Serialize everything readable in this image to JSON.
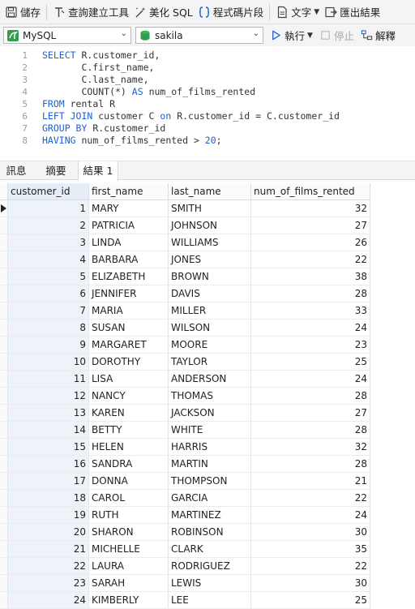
{
  "toolbar": {
    "save": "儲存",
    "query_builder": "查詢建立工具",
    "beautify": "美化 SQL",
    "snippet": "程式碼片段",
    "text": "文字",
    "export": "匯出結果"
  },
  "connection": {
    "engine": "MySQL",
    "database": "sakila",
    "run": "執行",
    "stop": "停止",
    "explain": "解釋"
  },
  "editor": {
    "lines": [
      {
        "n": "1",
        "parts": [
          {
            "t": "SELECT",
            "k": 1
          },
          {
            "t": " R.customer_id,",
            "k": 0
          }
        ]
      },
      {
        "n": "2",
        "parts": [
          {
            "t": "       C.first_name,",
            "k": 0
          }
        ]
      },
      {
        "n": "3",
        "parts": [
          {
            "t": "       C.last_name,",
            "k": 0
          }
        ]
      },
      {
        "n": "4",
        "parts": [
          {
            "t": "       COUNT(*) ",
            "k": 0
          },
          {
            "t": "AS",
            "k": 1
          },
          {
            "t": " num_of_films_rented",
            "k": 0
          }
        ]
      },
      {
        "n": "5",
        "parts": [
          {
            "t": "FROM",
            "k": 1
          },
          {
            "t": " rental R",
            "k": 0
          }
        ]
      },
      {
        "n": "6",
        "parts": [
          {
            "t": "LEFT JOIN",
            "k": 1
          },
          {
            "t": " customer C ",
            "k": 0
          },
          {
            "t": "on",
            "k": 1
          },
          {
            "t": " R.customer_id = C.customer_id",
            "k": 0
          }
        ]
      },
      {
        "n": "7",
        "parts": [
          {
            "t": "GROUP BY",
            "k": 1
          },
          {
            "t": " R.customer_id",
            "k": 0
          }
        ]
      },
      {
        "n": "8",
        "parts": [
          {
            "t": "HAVING",
            "k": 1
          },
          {
            "t": " num_of_films_rented > ",
            "k": 0
          },
          {
            "t": "20",
            "k": 2
          },
          {
            "t": ";",
            "k": 0
          }
        ]
      }
    ]
  },
  "tabs": [
    "訊息",
    "摘要",
    "結果 1"
  ],
  "grid": {
    "columns": [
      "customer_id",
      "first_name",
      "last_name",
      "num_of_films_rented"
    ],
    "rows": [
      [
        "1",
        "MARY",
        "SMITH",
        "32"
      ],
      [
        "2",
        "PATRICIA",
        "JOHNSON",
        "27"
      ],
      [
        "3",
        "LINDA",
        "WILLIAMS",
        "26"
      ],
      [
        "4",
        "BARBARA",
        "JONES",
        "22"
      ],
      [
        "5",
        "ELIZABETH",
        "BROWN",
        "38"
      ],
      [
        "6",
        "JENNIFER",
        "DAVIS",
        "28"
      ],
      [
        "7",
        "MARIA",
        "MILLER",
        "33"
      ],
      [
        "8",
        "SUSAN",
        "WILSON",
        "24"
      ],
      [
        "9",
        "MARGARET",
        "MOORE",
        "23"
      ],
      [
        "10",
        "DOROTHY",
        "TAYLOR",
        "25"
      ],
      [
        "11",
        "LISA",
        "ANDERSON",
        "24"
      ],
      [
        "12",
        "NANCY",
        "THOMAS",
        "28"
      ],
      [
        "13",
        "KAREN",
        "JACKSON",
        "27"
      ],
      [
        "14",
        "BETTY",
        "WHITE",
        "28"
      ],
      [
        "15",
        "HELEN",
        "HARRIS",
        "32"
      ],
      [
        "16",
        "SANDRA",
        "MARTIN",
        "28"
      ],
      [
        "17",
        "DONNA",
        "THOMPSON",
        "21"
      ],
      [
        "18",
        "CAROL",
        "GARCIA",
        "22"
      ],
      [
        "19",
        "RUTH",
        "MARTINEZ",
        "24"
      ],
      [
        "20",
        "SHARON",
        "ROBINSON",
        "30"
      ],
      [
        "21",
        "MICHELLE",
        "CLARK",
        "35"
      ],
      [
        "22",
        "LAURA",
        "RODRIGUEZ",
        "22"
      ],
      [
        "23",
        "SARAH",
        "LEWIS",
        "30"
      ],
      [
        "24",
        "KIMBERLY",
        "LEE",
        "25"
      ]
    ]
  },
  "colors": {
    "keyword": "#1b5fd6",
    "selected_column": "#eef3fa",
    "toolbar_bg": "#f4f4f4"
  }
}
